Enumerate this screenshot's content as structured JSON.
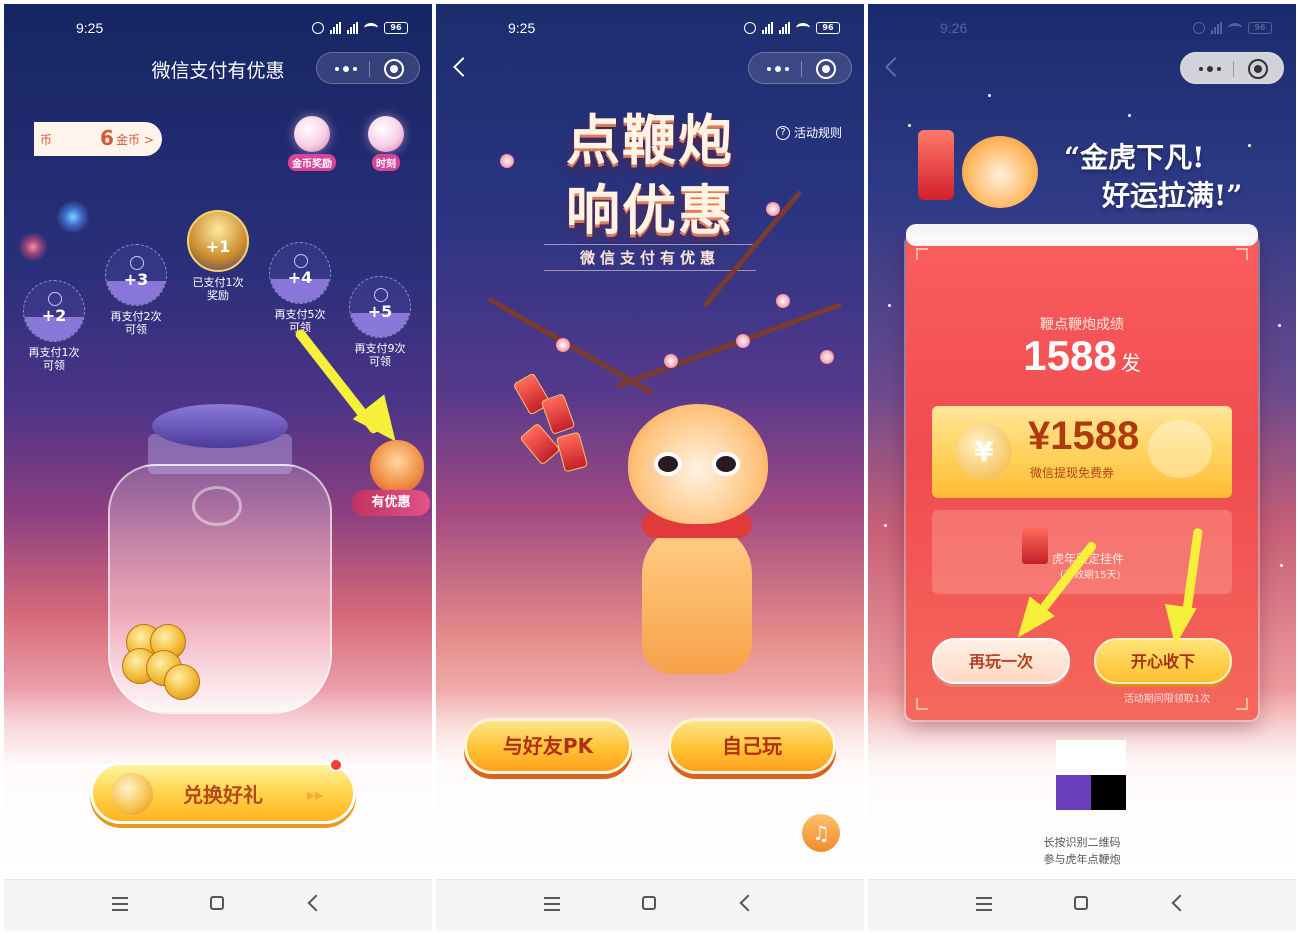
{
  "screen1": {
    "status": {
      "time": "9:25",
      "battery": "96"
    },
    "title": "微信支付有优惠",
    "coin_pill": {
      "prefix": "币",
      "count": "6",
      "unit": "金币",
      "chevron": ">"
    },
    "top_icons": [
      {
        "label": "金币奖励"
      },
      {
        "label": "时刻"
      }
    ],
    "progress_nodes": [
      {
        "value": "+2",
        "label": "再支付1次\n可领"
      },
      {
        "value": "+3",
        "label": "再支付2次\n可领"
      },
      {
        "value": "+1",
        "label": "已支付1次\n奖励"
      },
      {
        "value": "+4",
        "label": "再支付5次\n可领"
      },
      {
        "value": "+5",
        "label": "再支付9次\n可领"
      }
    ],
    "promo_tag": "有优惠",
    "redeem_button": "兑换好礼",
    "redeem_arrows": "▸▸"
  },
  "screen2": {
    "status": {
      "time": "9:25",
      "battery": "96"
    },
    "rules_label": "活动规则",
    "rules_icon": "?",
    "headline_line1": "点鞭炮",
    "headline_line2": "响优惠",
    "subheadline": "微信支付有优惠",
    "pk_button": "与好友PK",
    "solo_button": "自己玩",
    "music_icon": "♫"
  },
  "screen3": {
    "status": {
      "time": "9:26",
      "battery": "96"
    },
    "quote_line1": "“金虎下凡!",
    "quote_line2": "好运拉满!”",
    "result": {
      "label": "鞭点鞭炮成绩",
      "score": "1588",
      "unit": "发"
    },
    "coupon": {
      "yen_icon": "¥",
      "amount": "¥1588",
      "description": "微信提现免费券"
    },
    "pendant": {
      "title": "虎年限定挂件",
      "subtitle": "(有效期15天)"
    },
    "play_again_button": "再玩一次",
    "collect_button": "开心收下",
    "limit_note": "活动期间限领取1次",
    "qr_tip_line1": "长按识别二维码",
    "qr_tip_line2": "参与虎年点鞭炮"
  },
  "colors": {
    "night_sky": "#152663",
    "highlight_arrow": "#f6f03a",
    "button_gold": "#ffc334",
    "card_red": "#f04b4f"
  }
}
